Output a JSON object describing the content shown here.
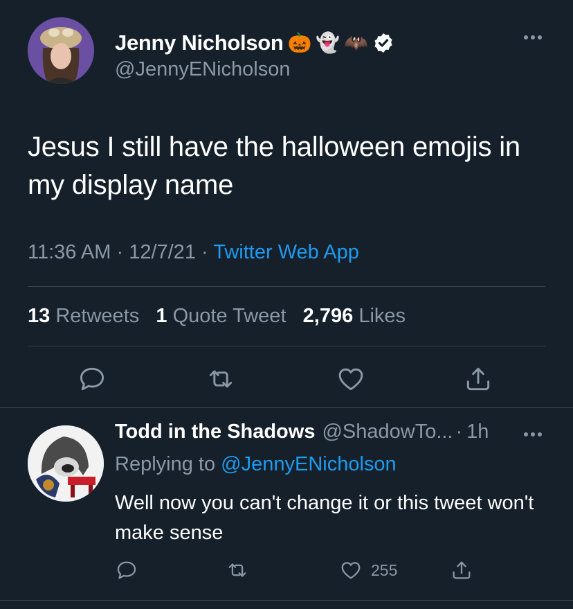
{
  "tweet": {
    "author": {
      "name": "Jenny Nicholson",
      "name_emojis": [
        "🎃",
        "👻",
        "🦇"
      ],
      "handle": "@JennyENicholson",
      "verified": true
    },
    "text": "Jesus I still have the halloween emojis in my display name",
    "time": "11:36 AM",
    "separator": "·",
    "date": "12/7/21",
    "source": "Twitter Web App",
    "stats": {
      "retweets_count": "13",
      "retweets_label": "Retweets",
      "quotes_count": "1",
      "quotes_label": "Quote Tweet",
      "likes_count": "2,796",
      "likes_label": "Likes"
    }
  },
  "reply": {
    "author_name": "Todd in the Shadows",
    "author_handle": "@ShadowTo...",
    "separator": "·",
    "time": "1h",
    "replying_label": "Replying to",
    "replying_handle": "@JennyENicholson",
    "text": "Well now you can't change it or this tweet won't make sense",
    "like_count": "255"
  },
  "colors": {
    "background": "#15202b",
    "text": "#ffffff",
    "muted": "#8b98a5",
    "accent": "#1d9bf0",
    "divider": "#38444d"
  },
  "icons": [
    "more-icon",
    "verified-badge-icon",
    "reply-icon",
    "retweet-icon",
    "like-icon",
    "share-icon"
  ]
}
